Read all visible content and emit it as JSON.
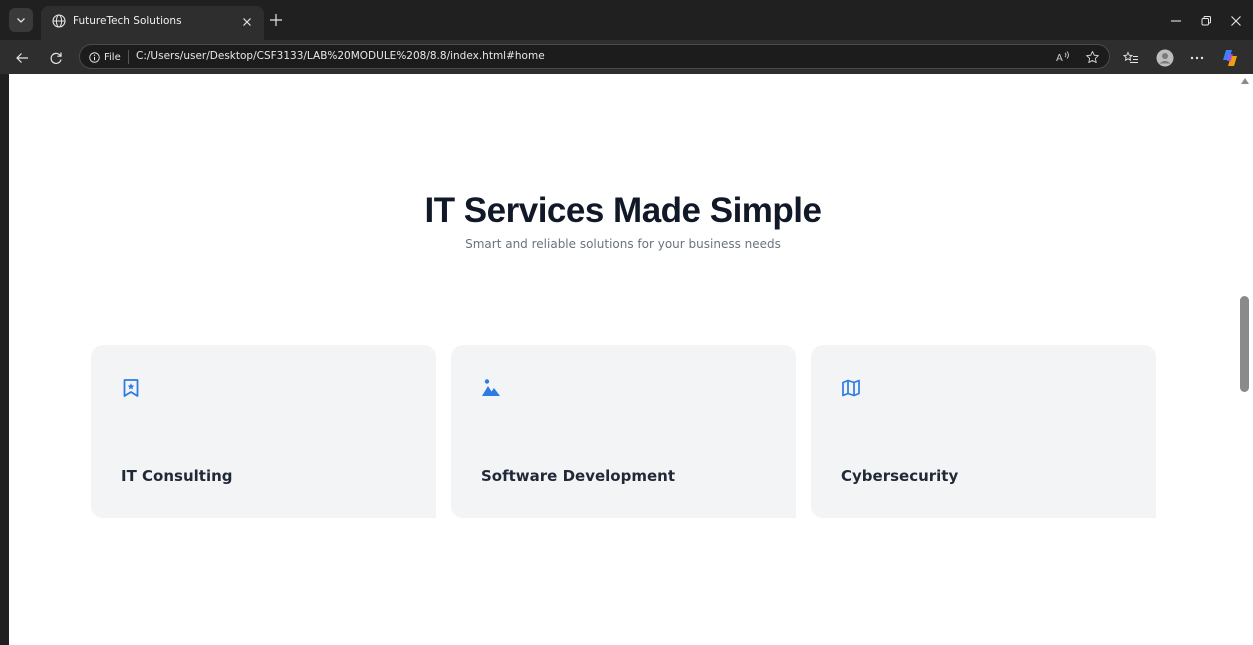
{
  "browser": {
    "tab_title": "FutureTech Solutions",
    "file_label": "File",
    "url": "C:/Users/user/Desktop/CSF3133/LAB%20MODULE%208/8.8/index.html#home"
  },
  "hero": {
    "title": "IT Services Made Simple",
    "subtitle": "Smart and reliable solutions for your business needs"
  },
  "services": [
    {
      "title": "IT Consulting",
      "icon": "bookmark-star-icon"
    },
    {
      "title": "Software Development",
      "icon": "image-mountains-icon"
    },
    {
      "title": "Cybersecurity",
      "icon": "map-icon"
    }
  ],
  "colors": {
    "accent": "#2f7ae5",
    "card_bg": "#f3f4f6",
    "heading": "#111827",
    "muted": "#6b7280"
  }
}
